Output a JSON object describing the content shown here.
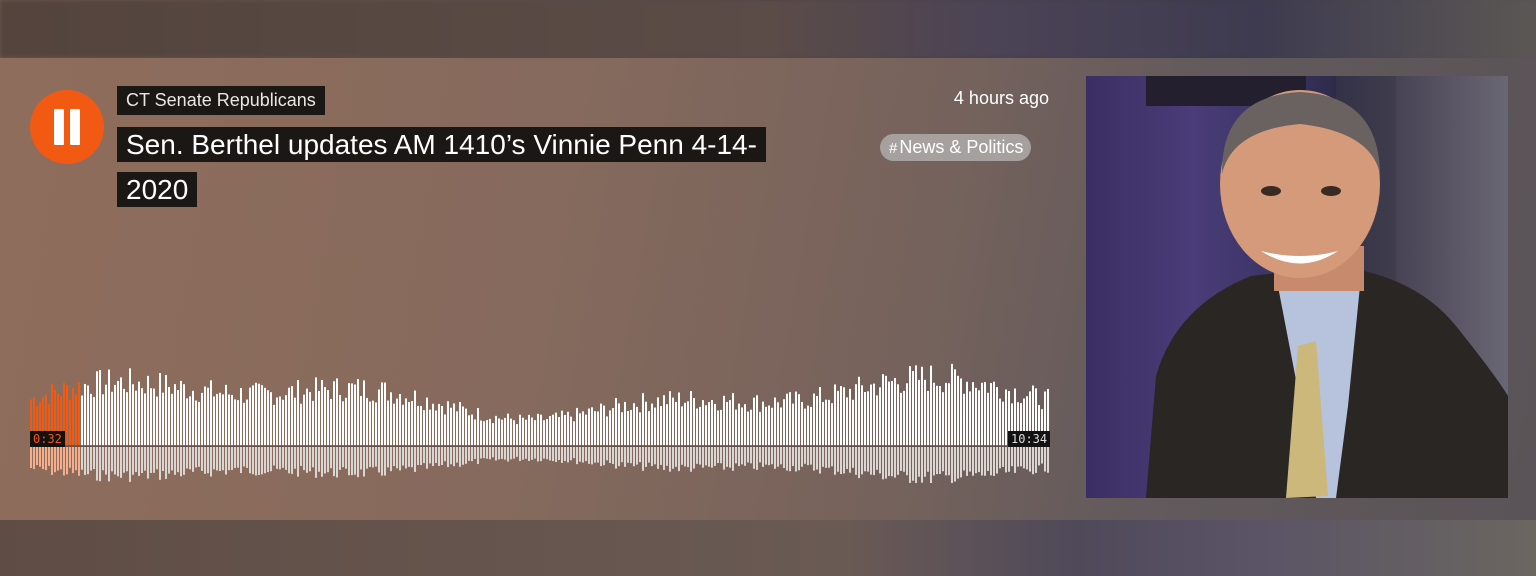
{
  "player": {
    "username": "CT Senate Republicans",
    "title": "Sen. Berthel updates AM 1410’s Vinnie Penn 4-14-2020",
    "timestamp": "4 hours ago",
    "tag": {
      "hash": "#",
      "label": "News & Politics"
    },
    "current_time": "0:32",
    "duration": "10:34",
    "progress": 0.05
  },
  "colors": {
    "accent": "#f25a14",
    "label_bg": "#1a1715",
    "waveform_unplayed": "#ffffff",
    "waveform_played": "#f25a14"
  },
  "icons": {
    "play_button": "pause-icon"
  }
}
